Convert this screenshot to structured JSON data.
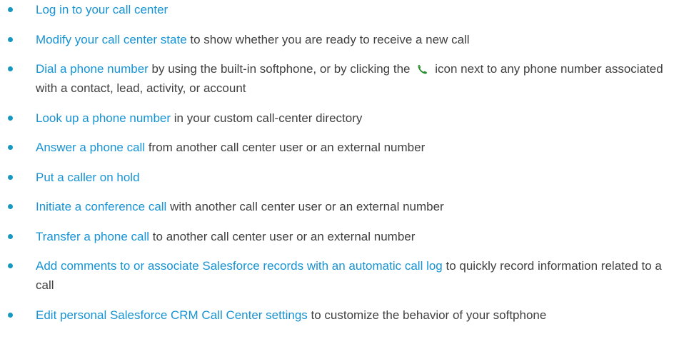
{
  "bullet_color": "#1798c1",
  "link_color": "#1793d3",
  "text_color": "#404040",
  "icons": {
    "phone": "phone-icon"
  },
  "items": [
    {
      "link": "Log in to your call center",
      "text": ""
    },
    {
      "link": "Modify your call center state",
      "text": " to show whether you are ready to receive a new call"
    },
    {
      "link": "Dial a phone number",
      "text": " by using the built-in softphone, or by clicking the",
      "text_after_icon": "icon next to any phone number associated with a contact, lead, activity, or account"
    },
    {
      "link": "Look up a phone number",
      "text": " in your custom call-center directory"
    },
    {
      "link": "Answer a phone call",
      "text": " from another call center user or an external number"
    },
    {
      "link": "Put a caller on hold",
      "text": ""
    },
    {
      "link": "Initiate a conference call",
      "text": " with another call center user or an external number"
    },
    {
      "link": "Transfer a phone call",
      "text": " to another call center user or an external number"
    },
    {
      "link": "Add comments to or associate Salesforce records with an automatic call log",
      "text": " to quickly record information related to a call"
    },
    {
      "link": "Edit personal Salesforce CRM Call Center settings",
      "text": " to customize the behavior of your softphone"
    }
  ]
}
